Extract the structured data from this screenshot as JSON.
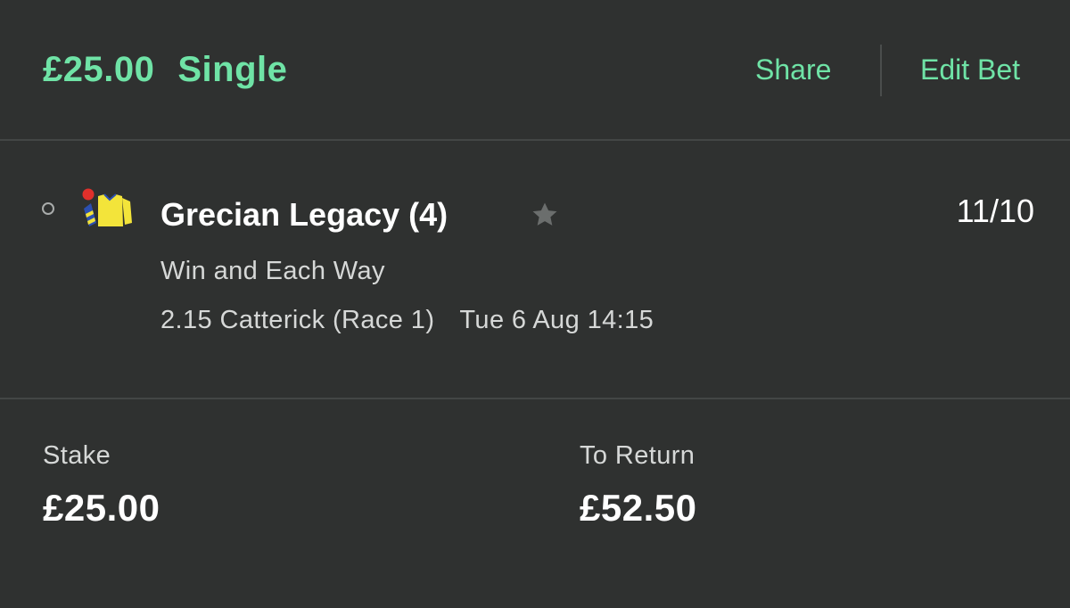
{
  "header": {
    "stake_amount": "£25.00",
    "bet_type": "Single",
    "share_label": "Share",
    "edit_label": "Edit Bet"
  },
  "selection": {
    "horse": "Grecian Legacy (4)",
    "odds": "11/10",
    "market": "Win and Each Way",
    "race": "2.15 Catterick (Race 1)",
    "datetime": "Tue 6 Aug 14:15",
    "silks_colors": {
      "body": "#f3e43a",
      "sleeves": "#2b4fb0",
      "cap": "#e0302b"
    },
    "icons": [
      "status-dot-icon",
      "jockey-silks-icon",
      "star-icon"
    ]
  },
  "summary": {
    "stake_label": "Stake",
    "stake_value": "£25.00",
    "return_label": "To Return",
    "return_value": "£52.50"
  },
  "colors": {
    "accent": "#6fe3a6",
    "background": "#2f3130"
  }
}
